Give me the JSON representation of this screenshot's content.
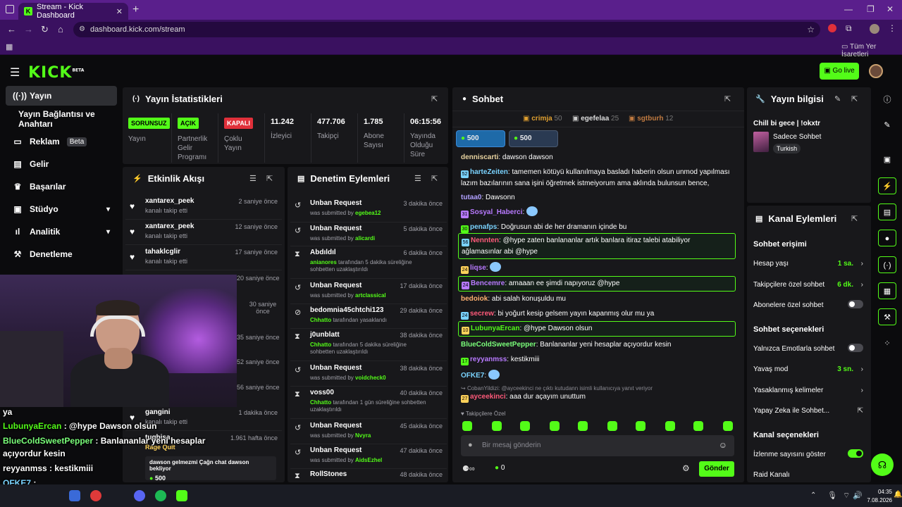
{
  "browser": {
    "tab_title": "Stream - Kick Dashboard",
    "url": "dashboard.kick.com/stream",
    "bookmarks_label": "Tüm Yer İşaretleri"
  },
  "header": {
    "logo": "KICK",
    "logo_badge": "BETA",
    "go_live": "Go live"
  },
  "sidebar": {
    "items": [
      {
        "label": "Yayın",
        "icon": "broadcast-icon"
      },
      {
        "label": "Yayın Bağlantısı ve Anahtarı"
      },
      {
        "label": "Reklam",
        "badge": "Beta",
        "icon": "ads-icon"
      },
      {
        "label": "Gelir",
        "icon": "chart-icon"
      },
      {
        "label": "Başarılar",
        "icon": "trophy-icon"
      },
      {
        "label": "Stüdyo",
        "icon": "studio-icon"
      },
      {
        "label": "Analitik",
        "icon": "analytics-icon"
      },
      {
        "label": "Denetleme",
        "icon": "hammer-icon"
      }
    ]
  },
  "stats": {
    "title": "Yayın İstatistikleri",
    "items": [
      {
        "tag": "SORUNSUZ",
        "label": "Yayın"
      },
      {
        "tag": "AÇIK",
        "label": "Partnerlik Gelir Programı"
      },
      {
        "tag": "KAPALI",
        "label": "Çoklu Yayın"
      },
      {
        "value": "11.242",
        "label": "İzleyici"
      },
      {
        "value": "477.706",
        "label": "Takipçi"
      },
      {
        "value": "1.785",
        "label": "Abone Sayısı"
      },
      {
        "value": "06:15:56",
        "label": "Yayında Olduğu Süre"
      }
    ]
  },
  "activity": {
    "title": "Etkinlik Akışı",
    "items": [
      {
        "name": "xantarex_peek",
        "sub": "kanalı takip etti",
        "time": "2 saniye önce"
      },
      {
        "name": "xantarex_peek",
        "sub": "kanalı takip etti",
        "time": "12 saniye önce"
      },
      {
        "name": "tahaklcglir",
        "sub": "kanalı takip etti",
        "time": "17 saniye önce"
      }
    ],
    "hidden_times": [
      "20 saniye önce",
      "30 saniye önce",
      "35 saniye önce",
      "52 saniye önce",
      "56 saniye önce"
    ],
    "after": [
      {
        "name": "gangini",
        "sub": "kanalı takip etti",
        "time": "1 dakika önce"
      },
      {
        "name": "tugbisa",
        "sub": "Rage Quit",
        "time": "1.961 hafta önce"
      }
    ],
    "gift_message": "dawson gelmezmi Çağn chat dawson bekliyor",
    "gift_amount": "500"
  },
  "moderation": {
    "title": "Denetim Eylemleri",
    "items": [
      {
        "icon": "undo-icon",
        "name": "Unban Request",
        "pre": "was submitted by ",
        "user": "egebea12",
        "post": "",
        "time": "3 dakika önce"
      },
      {
        "icon": "undo-icon",
        "name": "Unban Request",
        "pre": "was submitted by ",
        "user": "alicardi",
        "post": "",
        "time": "5 dakika önce"
      },
      {
        "icon": "hourglass-icon",
        "name": "Abdıldıl",
        "pre": "",
        "user": "anianores",
        "post": " tarafından 5 dakika süreliğine sohbetten uzaklaştırıldı",
        "time": "6 dakika önce"
      },
      {
        "icon": "undo-icon",
        "name": "Unban Request",
        "pre": "was submitted by ",
        "user": "artclassical",
        "post": "",
        "time": "17 dakika önce"
      },
      {
        "icon": "ban-icon",
        "name": "bedomnia45chtchi123",
        "pre": "",
        "user": "Chhatto",
        "post": " tarafından yasaklandı",
        "time": "29 dakika önce"
      },
      {
        "icon": "hourglass-icon",
        "name": "j0unblatt",
        "pre": "",
        "user": "Chhatto",
        "post": " tarafından 5 dakika süreliğine sohbetten uzaklaştırıldı",
        "time": "38 dakika önce"
      },
      {
        "icon": "undo-icon",
        "name": "Unban Request",
        "pre": "was submitted by ",
        "user": "voidcheck0",
        "post": "",
        "time": "38 dakika önce"
      },
      {
        "icon": "hourglass-icon",
        "name": "voss00",
        "pre": "",
        "user": "Chhatto",
        "post": " tarafından 1 gün süreliğine sohbetten uzaklaştırıldı",
        "time": "40 dakika önce"
      },
      {
        "icon": "undo-icon",
        "name": "Unban Request",
        "pre": "was submitted by ",
        "user": "Nvyra",
        "post": "",
        "time": "45 dakika önce"
      },
      {
        "icon": "undo-icon",
        "name": "Unban Request",
        "pre": "was submitted by ",
        "user": "AidsEzhel",
        "post": "",
        "time": "47 dakika önce"
      },
      {
        "icon": "hourglass-icon",
        "name": "RollStones",
        "pre": "",
        "user": "",
        "post": "",
        "time": "48 dakika önce"
      }
    ]
  },
  "chat": {
    "title": "Sohbet",
    "top_gifters": [
      {
        "name": "crimja",
        "count": "50",
        "rank": "1"
      },
      {
        "name": "egefelaa",
        "count": "25",
        "rank": "2"
      },
      {
        "name": "sgtburh",
        "count": "12",
        "rank": "3"
      }
    ],
    "pinned_amounts": [
      "500",
      "500"
    ],
    "messages": [
      {
        "user": "denniscarti",
        "color": "#e8d3a0",
        "text": "dawson dawson"
      },
      {
        "user": "harteZeiten",
        "color": "#7ad3ff",
        "badge": "52",
        "text": "tamemen kötüyü kullanılmaya basladı haberin olsun unmod yapılması lazım bazılarının sana işini öğretmek istmeiyorum ama aklında bulunsun bence,"
      },
      {
        "user": "tutaa0",
        "color": "#b0a0ff",
        "text": "Dawsonn"
      },
      {
        "user": "Sosyal_Haberci",
        "color": "#b87aff",
        "badge": "31",
        "text": ""
      },
      {
        "user": "penafps",
        "color": "#7ad3ff",
        "badge": "30",
        "text": "Doğrusun abi de her dramanın içinde bu"
      },
      {
        "user": "Nennten",
        "color": "#ff5a7a",
        "badge": "56",
        "text": "@hype zaten banlananlar artık banlara itiraz talebi atabiliyor ağlamasınlar abi @hype",
        "highlight": true
      },
      {
        "user": "liqse",
        "color": "#b87aff",
        "badge": "24",
        "text": ""
      },
      {
        "user": "Bencemre",
        "color": "#b87aff",
        "badge": "24",
        "text": "amaaan ee şimdi napıyoruz @hype",
        "highlight": true
      },
      {
        "user": "bedoiok",
        "color": "#ffb070",
        "text": "abi salah konuşuldu mu"
      },
      {
        "user": "secrew",
        "color": "#ff5a7a",
        "badge": "24",
        "text": "bi yoğurt kesip gelsem yayın kapanmış olur mu ya"
      },
      {
        "user": "LubunyaErcan",
        "color": "#53fc18",
        "badge": "10",
        "text": "@hype Dawson olsun",
        "highlight": true
      },
      {
        "user": "BlueColdSweetPepper",
        "color": "#7aff7a",
        "text": "Banlananlar yeni hesaplar açıyordur kesin"
      },
      {
        "user": "reyyanmss",
        "color": "#b87aff",
        "badge": "17",
        "text": "kestikmiii"
      },
      {
        "user": "OFKE7",
        "color": "#7ad3ff",
        "text": ""
      },
      {
        "user": "ayceekinci",
        "color": "#ff5a7a",
        "badge": "27",
        "text": "aaa dur açayım unuttum"
      }
    ],
    "reply_hint": "CobanYildizi: @ayceekinci ne çıktı kutudann isimli kullanıcıya yanıt veriyor",
    "followers_only": "Takipçilere Özel",
    "input_placeholder": "Bir mesaj gönderin",
    "coin_count": "0",
    "send_label": "Gönder"
  },
  "stream_info": {
    "title": "Yayın bilgisi",
    "stream_title": "Chill bi gece | !okxtr",
    "category": "Sadece Sohbet",
    "language": "Turkish"
  },
  "channel_actions": {
    "title": "Kanal Eylemleri",
    "sections": [
      {
        "heading": "Sohbet erişimi",
        "rows": [
          {
            "label": "Hesap yaşı",
            "value": "1 sa.",
            "kind": "chev"
          },
          {
            "label": "Takipçilere özel sohbet",
            "value": "6 dk.",
            "kind": "chev"
          },
          {
            "label": "Abonelere özel sohbet",
            "kind": "toggle",
            "on": false
          }
        ]
      },
      {
        "heading": "Sohbet seçenekleri",
        "rows": [
          {
            "label": "Yalnızca Emotlarla sohbet",
            "kind": "toggle",
            "on": false
          },
          {
            "label": "Yavaş mod",
            "value": "3 sn.",
            "kind": "chev"
          },
          {
            "label": "Yasaklanmış kelimeler",
            "kind": "chev"
          },
          {
            "label": "Yapay Zeka ile Sohbet...",
            "kind": "ext"
          }
        ]
      },
      {
        "heading": "Kanal seçenekleri",
        "rows": [
          {
            "label": "İzlenme sayısını göster",
            "kind": "toggle",
            "on": true
          },
          {
            "label": "Raid Kanalı",
            "kind": "none"
          }
        ]
      }
    ]
  },
  "overlay_chat": [
    {
      "user": "",
      "text": "ya"
    },
    {
      "user": "LubunyaErcan",
      "color": "#53fc18",
      "text": " : @hype Dawson olsun"
    },
    {
      "user": "BlueColdSweetPepper",
      "color": "#7aff7a",
      "text": " : Banlananlar yeni hesaplar"
    },
    {
      "user": "",
      "text": "açıyordur kesin"
    },
    {
      "user": "reyyanmss",
      "color": "#ffffff",
      "text": " : kestikmiii"
    },
    {
      "user": "OFKE7",
      "color": "#7ad3ff",
      "text": " :"
    },
    {
      "user": "ayceekinci",
      "color": "#ff5a7a",
      "text": " : aaa dur açayım unuttum"
    }
  ],
  "taskbar": {
    "time": "04:35",
    "date": "7.08.2026"
  },
  "colors": {
    "accent": "#53fc18",
    "panel": "#18181b",
    "bg": "#0b0b0d",
    "browser": "#5a1f8c"
  }
}
